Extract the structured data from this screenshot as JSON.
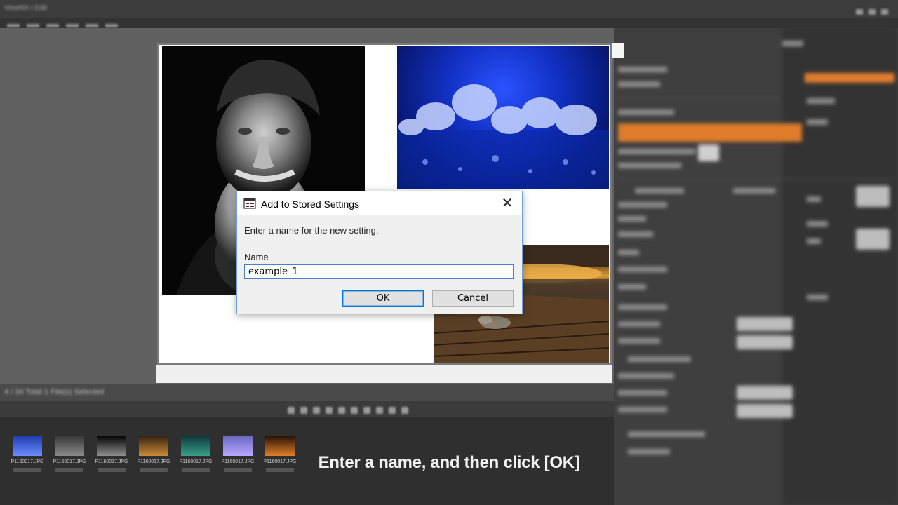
{
  "app": {
    "title": "ViewNX-i Edit"
  },
  "background": {
    "status_text": "4 / 34 Total 1 File(s) Selected"
  },
  "filmstrip": {
    "thumbnails": [
      {
        "caption": "P1160017.JPG",
        "colors": [
          "#1f3fb0",
          "#6a8cff"
        ]
      },
      {
        "caption": "P1160017.JPG",
        "colors": [
          "#3a3a3a",
          "#8a8a8a"
        ]
      },
      {
        "caption": "P1160017.JPG",
        "colors": [
          "#050505",
          "#8e8e8e"
        ]
      },
      {
        "caption": "P1160017.JPG",
        "colors": [
          "#3a2410",
          "#c88a3a"
        ]
      },
      {
        "caption": "P1160017.JPG",
        "colors": [
          "#0e3a3a",
          "#3aa08a"
        ]
      },
      {
        "caption": "P1160017.JPG",
        "colors": [
          "#6a6ac0",
          "#b6a8ff"
        ]
      },
      {
        "caption": "P1160017.JPG",
        "colors": [
          "#2a1208",
          "#e0802a"
        ]
      }
    ]
  },
  "dialog": {
    "title": "Add to Stored Settings",
    "prompt": "Enter a name for the new setting.",
    "name_label": "Name",
    "name_value": "example_1",
    "ok_label": "OK",
    "cancel_label": "Cancel",
    "close_glyph": "✕"
  },
  "caption": "Enter a name, and then click [OK]",
  "colors": {
    "accent_orange": "#e07c2c",
    "dialog_border": "#6f9ed9",
    "ok_focus": "#0078d7"
  }
}
